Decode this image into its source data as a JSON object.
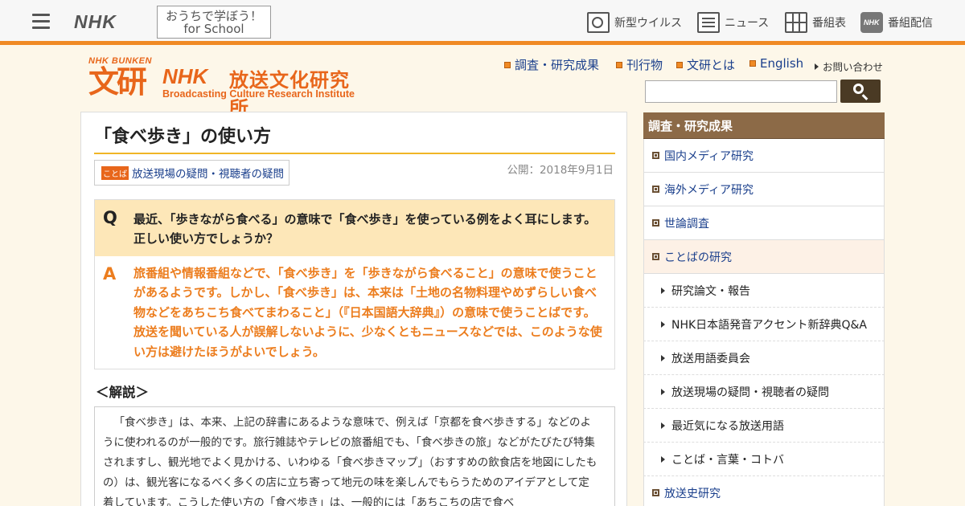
{
  "global_header": {
    "logo": "NHK",
    "school_line1": "おうちで学ぼう！",
    "school_line2": "for School",
    "nav": [
      {
        "label": "新型ウイルス",
        "icon": "virus-icon"
      },
      {
        "label": "ニュース",
        "icon": "news-icon"
      },
      {
        "label": "番組表",
        "icon": "program-table-icon"
      },
      {
        "label": "番組配信",
        "icon": "nhk-plus-icon"
      }
    ],
    "accent_color": "#f08a24"
  },
  "bunken_header": {
    "mark_top": "NHK BUNKEN",
    "mark": "文研",
    "nhk": "NHK",
    "name": "放送文化研究所",
    "name_en": "Broadcasting Culture Research Institute",
    "subnav": [
      "調査・研究成果",
      "刊行物",
      "文研とは",
      "English"
    ],
    "contact": "お問い合わせ",
    "search_placeholder": ""
  },
  "article": {
    "title": "「食べ歩き」の使い方",
    "category_badge": "ことば",
    "category": "放送現場の疑問・視聴者の疑問",
    "published": "公開：2018年9月1日",
    "q_mark": "Q",
    "question": "最近、「歩きながら食べる」の意味で「食べ歩き」を使っている例をよく耳にします。正しい使い方でしょうか？",
    "a_mark": "A",
    "answer": "旅番組や情報番組などで、「食べ歩き」を「歩きながら食べること」の意味で使うことがあるようです。しかし、「食べ歩き」は、本来は「土地の名物料理やめずらしい食べ物などをあちこち食べてまわること」（『日本国語大辞典』）の意味で使うことばです。放送を聞いている人が誤解しないように、少なくともニュースなどでは、このような使い方は避けたほうがよいでしょう。",
    "kaisetsu_heading": "＜解説＞",
    "kaisetsu_body": "「食べ歩き」は、本来、上記の辞書にあるような意味で、例えば「京都を食べ歩きする」などのように使われるのが一般的です。旅行雑誌やテレビの旅番組でも、「食べ歩きの旅」などがたびたび特集されますし、観光地でよく見かける、いわゆる「食べ歩きマップ」（おすすめの飲食店を地図にしたもの）は、観光客になるべく多くの店に立ち寄って地元の味を楽しんでもらうためのアイデアとして定着しています。こうした使い方の「食べ歩き」は、一般的には「あちこちの店で食べ"
  },
  "side_menu": {
    "heading": "調査・研究成果",
    "items": [
      {
        "label": "国内メディア研究",
        "level": 1
      },
      {
        "label": "海外メディア研究",
        "level": 1
      },
      {
        "label": "世論調査",
        "level": 1
      },
      {
        "label": "ことばの研究",
        "level": 1,
        "active": true
      },
      {
        "label": "研究論文・報告",
        "level": 2
      },
      {
        "label": "NHK日本語発音アクセント新辞典Q&A",
        "level": 2
      },
      {
        "label": "放送用語委員会",
        "level": 2
      },
      {
        "label": "放送現場の疑問・視聴者の疑問",
        "level": 2
      },
      {
        "label": "最近気になる放送用語",
        "level": 2
      },
      {
        "label": "ことば・言葉・コトバ",
        "level": 2
      },
      {
        "label": "放送史研究",
        "level": 1
      }
    ]
  }
}
